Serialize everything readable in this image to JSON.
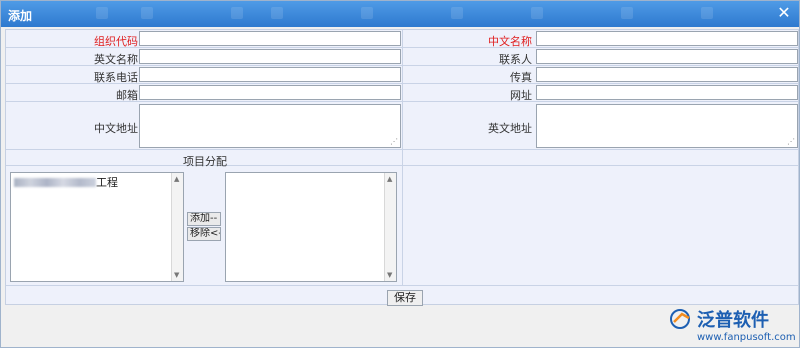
{
  "dialog": {
    "title": "添加",
    "close_glyph": "✕"
  },
  "form": {
    "org_code": {
      "label": "组织代码",
      "value": ""
    },
    "cn_name": {
      "label": "中文名称",
      "value": ""
    },
    "en_name": {
      "label": "英文名称",
      "value": ""
    },
    "contact": {
      "label": "联系人",
      "value": ""
    },
    "phone": {
      "label": "联系电话",
      "value": ""
    },
    "fax": {
      "label": "传真",
      "value": ""
    },
    "email": {
      "label": "邮箱",
      "value": ""
    },
    "website": {
      "label": "网址",
      "value": ""
    },
    "cn_address": {
      "label": "中文地址",
      "value": ""
    },
    "en_address": {
      "label": "英文地址",
      "value": ""
    }
  },
  "project_assign": {
    "label": "项目分配",
    "available_items": [
      "工程"
    ],
    "add_label": "添加--",
    "remove_label": "移除<--"
  },
  "save_label": "保存",
  "watermark": {
    "brand": "泛普软件",
    "url": "www.fanpusoft.com"
  },
  "colors": {
    "required": "#e02020",
    "title_bar": "#3a86dc",
    "form_bg": "#eef1fb"
  }
}
